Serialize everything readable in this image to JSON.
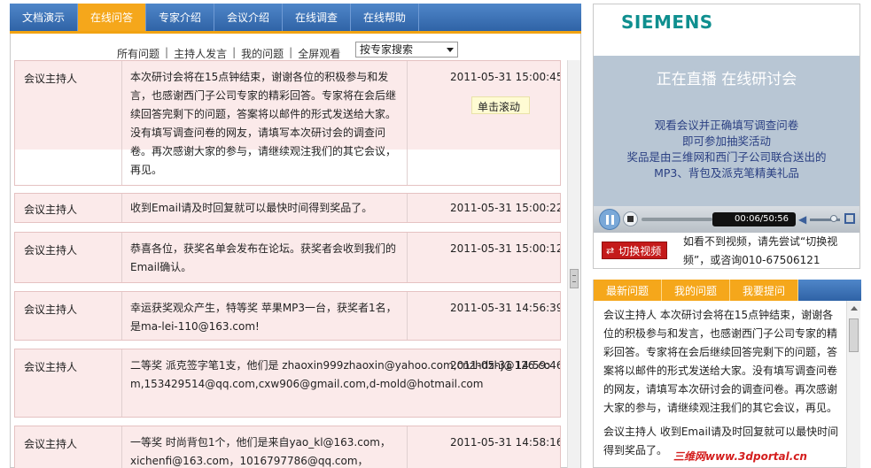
{
  "tabs": [
    {
      "label": "文档演示"
    },
    {
      "label": "在线问答"
    },
    {
      "label": "专家介绍"
    },
    {
      "label": "会议介绍"
    },
    {
      "label": "在线调查"
    },
    {
      "label": "在线帮助"
    }
  ],
  "filter": {
    "links": [
      "所有问题",
      "主持人发言",
      "我的问题",
      "全屏观看"
    ],
    "separator": "|",
    "select_value": "按专家搜索"
  },
  "messages": [
    {
      "author": "会议主持人",
      "text": "本次研讨会将在15点钟结束，谢谢各位的积极参与和发言，也感谢西门子公司专家的精彩回答。专家将在会后继续回答完剩下的问题，答案将以邮件的形式发送给大家。没有填写调查问卷的网友，请填写本次研讨会的调查问卷。再次感谢大家的参与，请继续观注我们的其它会议，再见。",
      "time": "2011-05-31 15:00:45"
    },
    {
      "author": "会议主持人",
      "text": "收到Email请及时回复就可以最快时间得到奖品了。",
      "time": "2011-05-31 15:00:22"
    },
    {
      "author": "会议主持人",
      "text": "恭喜各位，获奖名单会发布在论坛。获奖者会收到我们的Email确认。",
      "time": "2011-05-31 15:00:12"
    },
    {
      "author": "会议主持人",
      "text": "幸运获奖观众产生，特等奖 苹果MP3一台，获奖者1名，是ma-lei-110@163.com!",
      "time": "2011-05-31 14:56:39"
    },
    {
      "author": "会议主持人",
      "text": "二等奖 派克签字笔1支，他们是 zhaoxin999zhaoxin@yahoo.com,cnzhdzhj@126.com,153429514@qq.com,cxw906@gmail.com,d-mold@hotmail.com",
      "time": "2011-05-31 14:59:46"
    },
    {
      "author": "会议主持人",
      "text": "一等奖 时尚背包1个，他们是来自yao_kl@163.com，xichenfi@163.com，1016797786@qq.com，",
      "time": "2011-05-31 14:58:16"
    }
  ],
  "scroll_tip": "单击滚动",
  "player": {
    "logo": "SIEMENS",
    "live_title": "正在直播  在线研讨会",
    "desc_lines": [
      "观看会议并正确填写调查问卷",
      "即可参加抽奖活动",
      "奖品是由三维网和西门子公司联合送出的",
      "MP3、背包及派克笔精美礼品"
    ],
    "time": "00:06/50:56",
    "icons": {
      "play": "pause-icon",
      "stop": "stop-icon",
      "volume": "volume-icon",
      "fullscreen": "fullscreen-icon"
    }
  },
  "switch": {
    "button_label": "切换视频",
    "help_text": "如看不到视频，请先尝试“切换视频”，或咨询010-67506121"
  },
  "qtabs": [
    {
      "label": "最新问题"
    },
    {
      "label": "我的问题"
    },
    {
      "label": "我要提问"
    }
  ],
  "latest": [
    "会议主持人 本次研讨会将在15点钟结束，谢谢各位的积极参与和发言，也感谢西门子公司专家的精彩回答。专家将在会后继续回答完剩下的问题，答案将以邮件的形式发送给大家。没有填写调查问卷的网友，请填写本次研讨会的调查问卷。再次感谢大家的参与，请继续观注我们的其它会议，再见。",
    "会议主持人 收到Email请及时回复就可以最快时间得到奖品了。"
  ],
  "watermark": "三维网www.3dportal.cn"
}
